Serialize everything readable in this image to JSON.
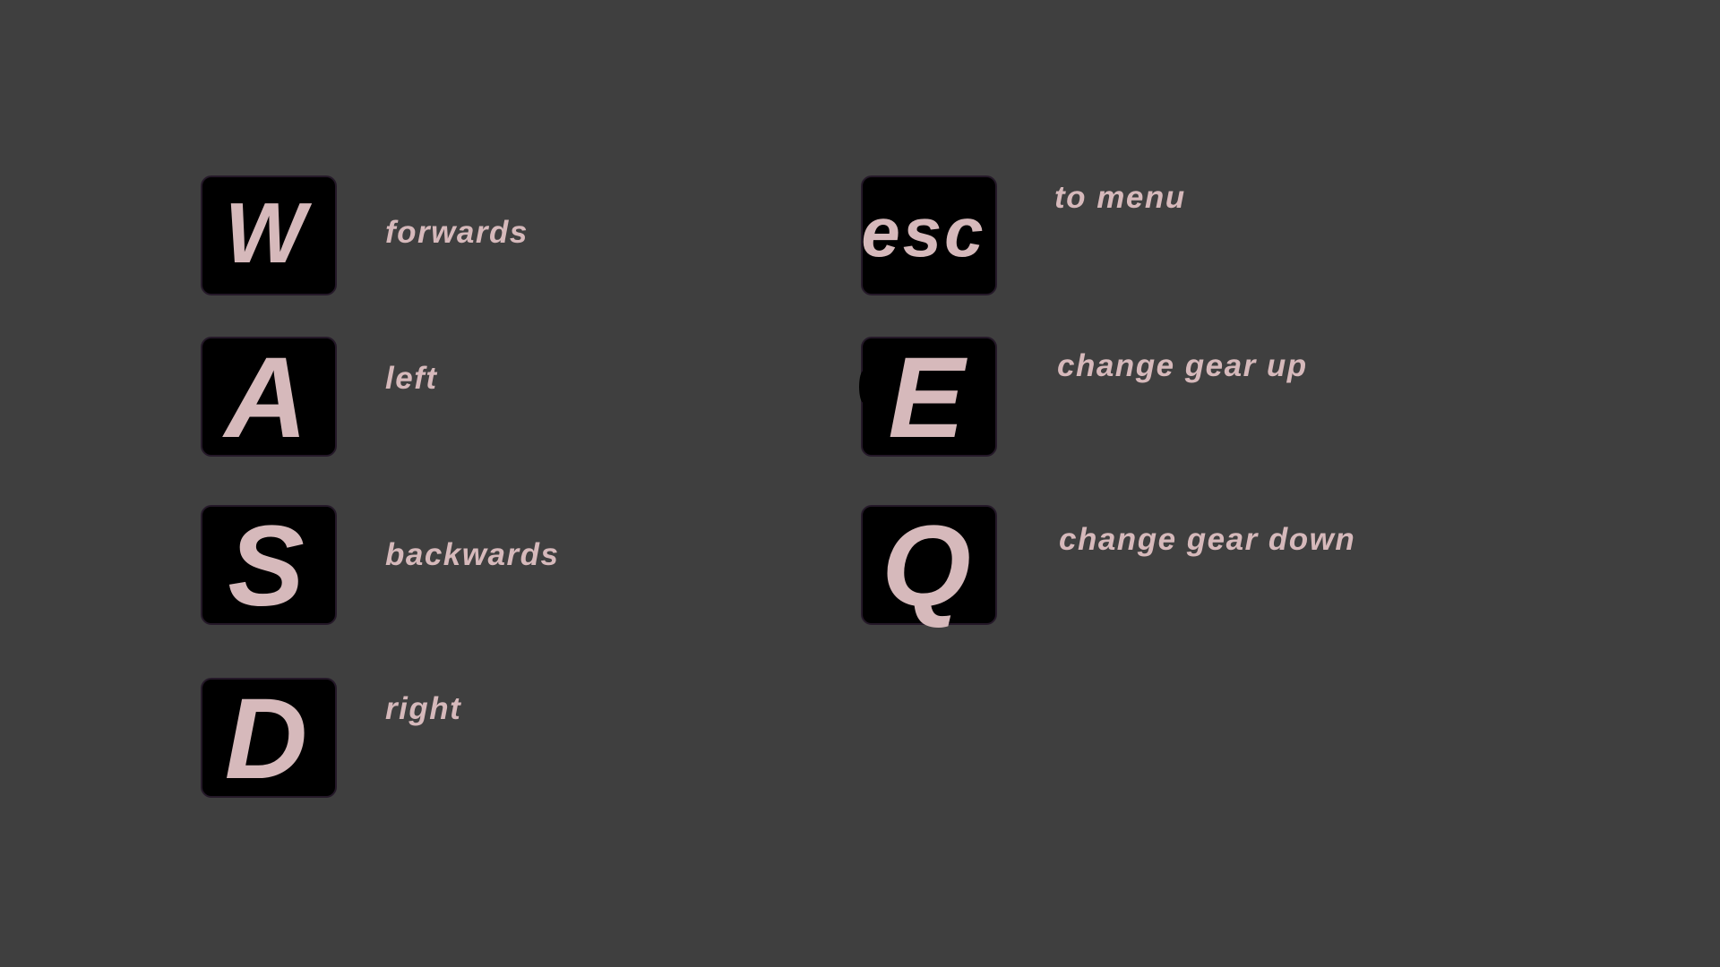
{
  "colors": {
    "background": "#3f3f3f",
    "key_fill": "#000000",
    "key_border": "#241828",
    "text": "#d6b9bb"
  },
  "controls": {
    "movement": [
      {
        "key": "W",
        "action": "forwards"
      },
      {
        "key": "A",
        "action": "left"
      },
      {
        "key": "S",
        "action": "backwards"
      },
      {
        "key": "D",
        "action": "right"
      }
    ],
    "other": [
      {
        "key": "esc",
        "action": "to menu"
      },
      {
        "key": "E",
        "action": "change gear up"
      },
      {
        "key": "Q",
        "action": "change gear down"
      }
    ]
  }
}
